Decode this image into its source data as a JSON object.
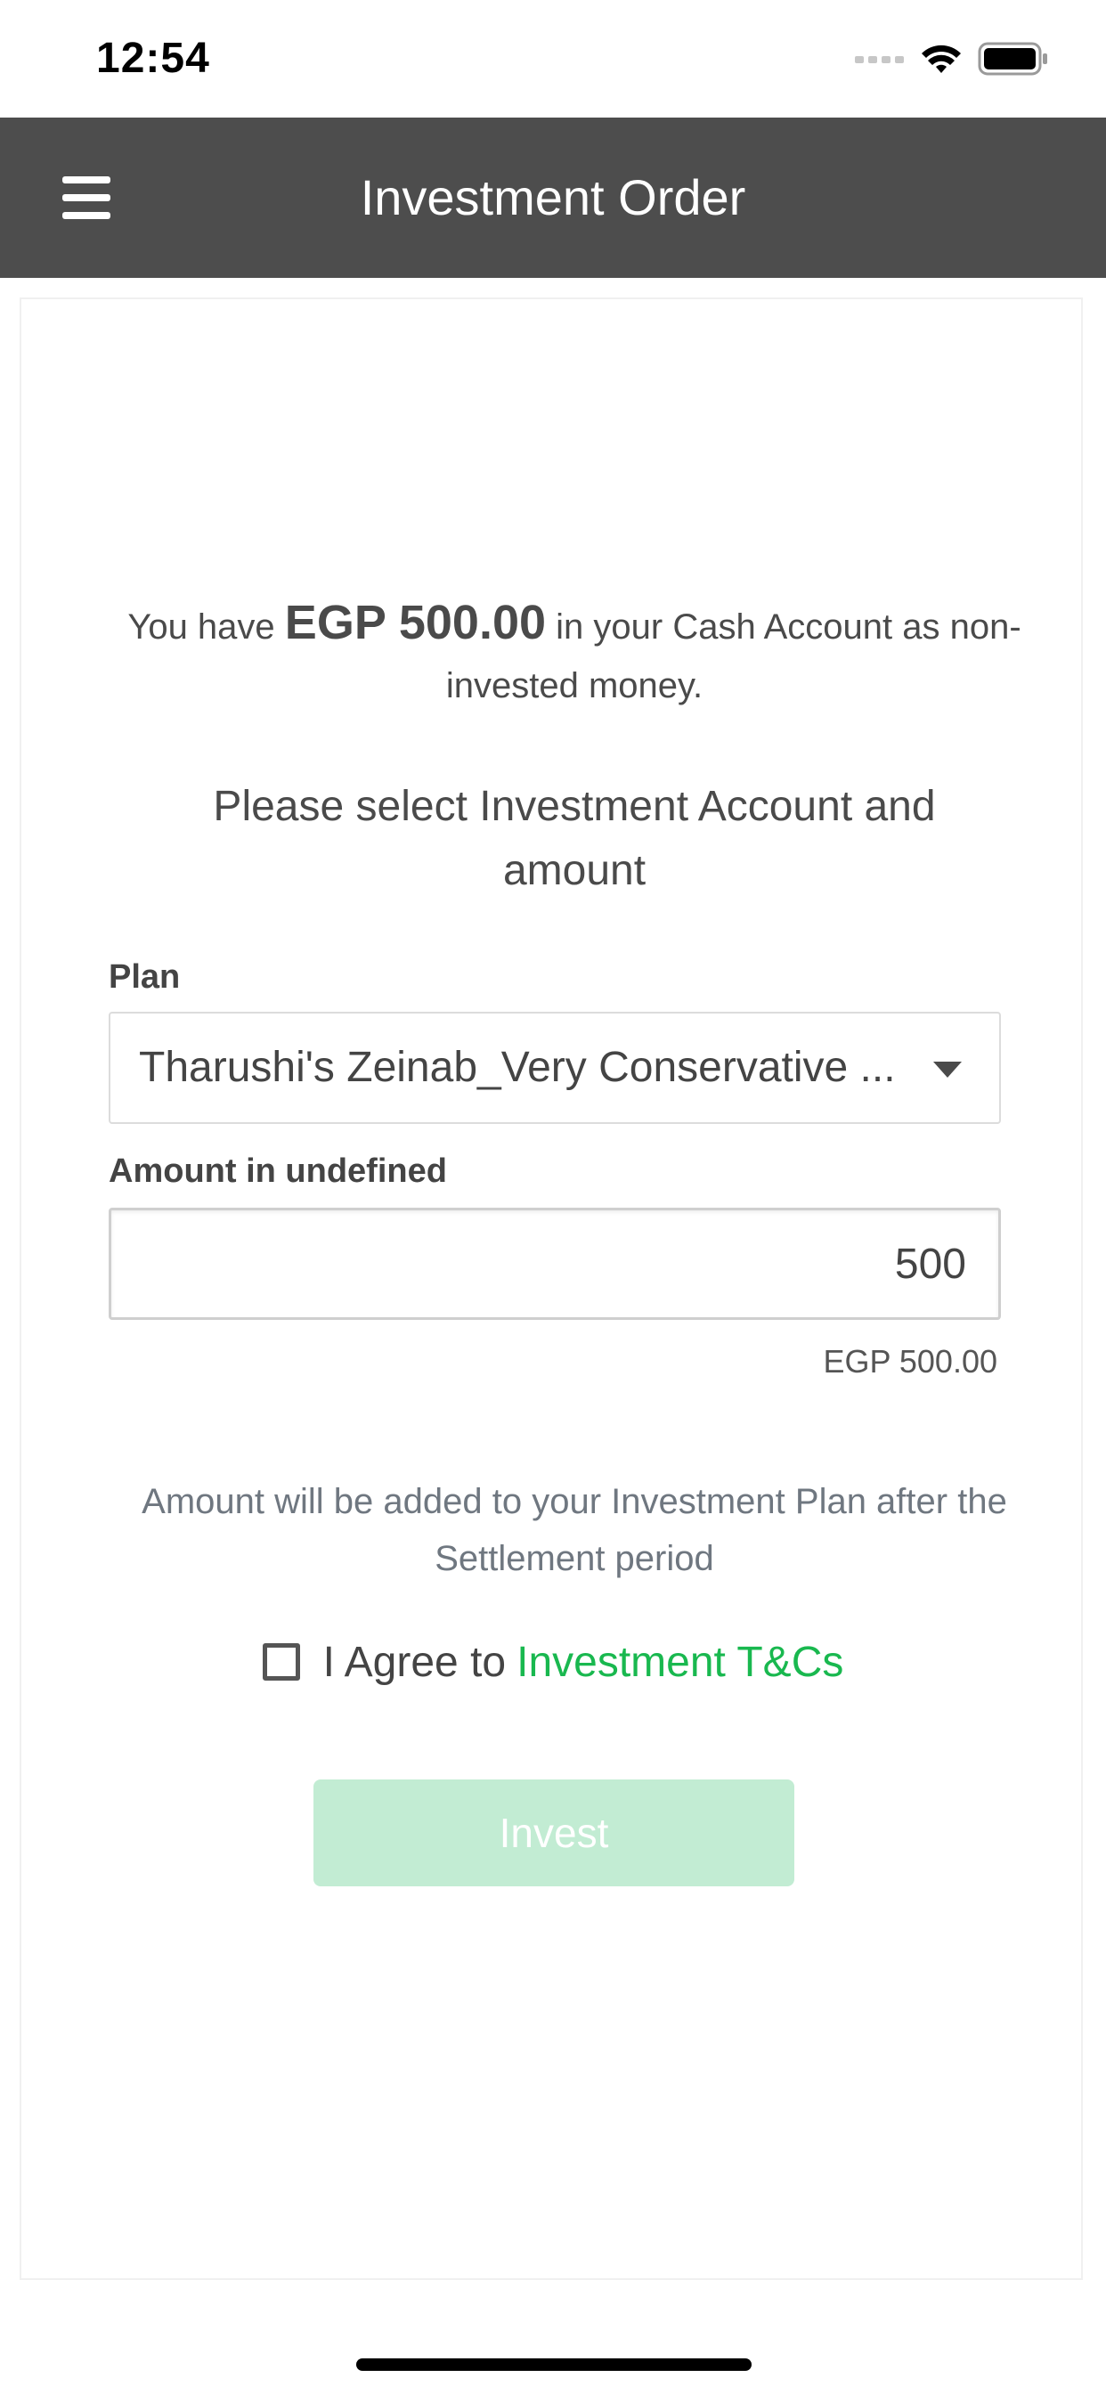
{
  "status_bar": {
    "time": "12:54",
    "icons": [
      "signal-icon",
      "wifi-icon",
      "battery-icon"
    ]
  },
  "header": {
    "title": "Investment Order",
    "menu_icon": "menu-icon",
    "background": "#4d4d4d"
  },
  "balance": {
    "prefix": "You have",
    "amount": "EGP 500.00",
    "suffix": "in your Cash Account as non-invested money."
  },
  "instruction": "Please select Investment Account and amount",
  "plan": {
    "label": "Plan",
    "selected_value": "Tharushi's Zeinab_Very Conservative ...",
    "icon": "caret-down-icon"
  },
  "amount": {
    "label": "Amount in undefined",
    "value": "500",
    "formatted": "EGP 500.00"
  },
  "settlement_note": "Amount will be added to your Investment Plan after the Settlement period",
  "agreement": {
    "checked": false,
    "text": "I Agree to",
    "link_text": "Investment T&Cs",
    "link_color": "#19b84f"
  },
  "invest_button": {
    "label": "Invest",
    "enabled": false,
    "color": "#c2ecd3"
  }
}
